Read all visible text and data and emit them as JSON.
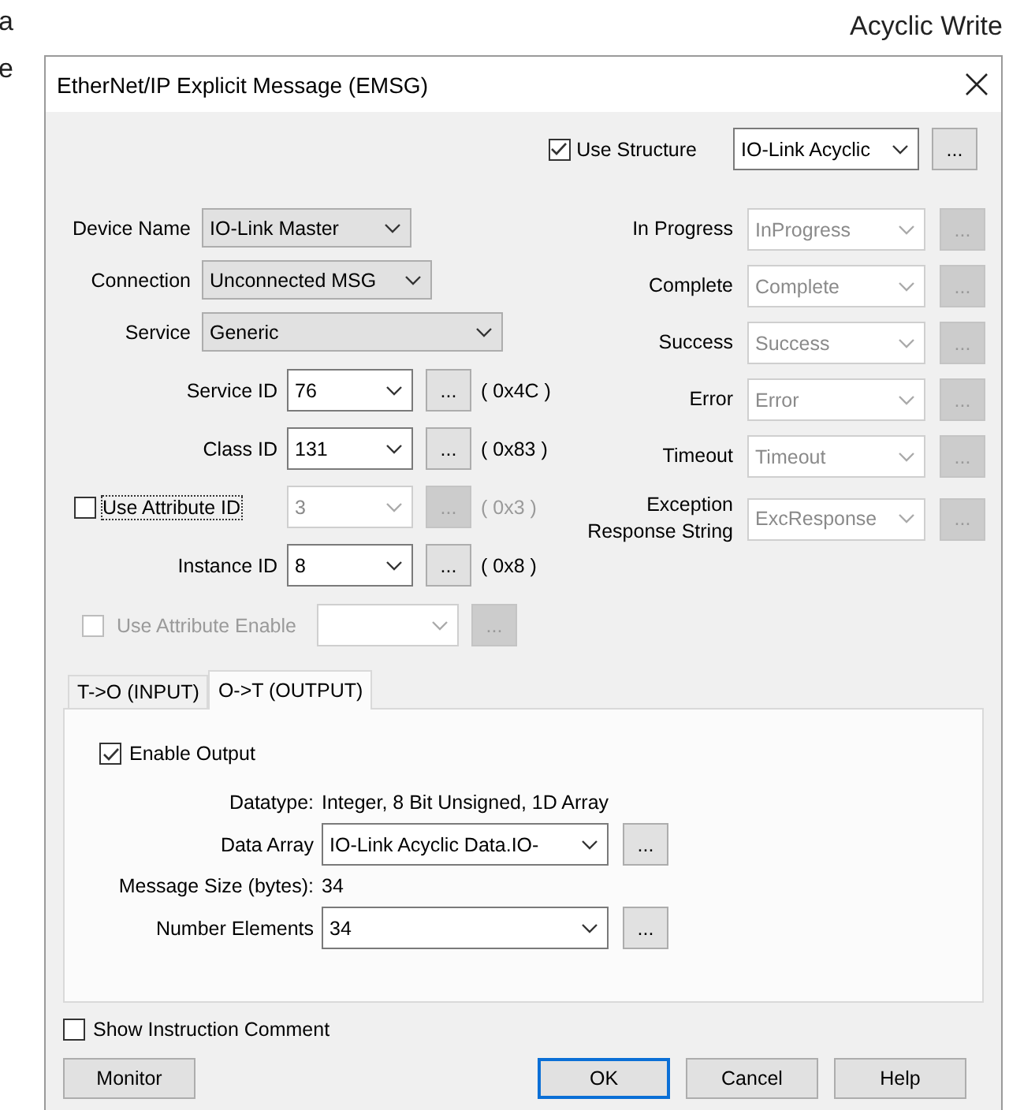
{
  "page_fragments": {
    "left_line_1": "a",
    "left_line_2": "e",
    "heading": "Acyclic Write"
  },
  "window": {
    "title": "EtherNet/IP Explicit Message (EMSG)"
  },
  "use_structure": {
    "label": "Use Structure",
    "checked": true,
    "value": "IO-Link Acyclic",
    "button": "..."
  },
  "left_fields": [
    {
      "kind": "select",
      "label": "Device Name",
      "value": "IO-Link Master",
      "disabled": false
    },
    {
      "kind": "select",
      "label": "Connection",
      "value": "Unconnected MSG",
      "disabled": false
    },
    {
      "kind": "select",
      "label": "Service",
      "value": "Generic",
      "disabled": false
    },
    {
      "kind": "id",
      "label": "Service ID",
      "value": "76",
      "button": "...",
      "hex": "( 0x4C )",
      "disabled": false
    },
    {
      "kind": "id",
      "label": "Class ID",
      "value": "131",
      "button": "...",
      "hex": "( 0x83 )",
      "disabled": false
    },
    {
      "kind": "id_check",
      "label": "Use Attribute ID",
      "checked": false,
      "value": "3",
      "button": "...",
      "hex": "( 0x3 )",
      "disabled": true
    },
    {
      "kind": "id",
      "label": "Instance ID",
      "value": "8",
      "button": "...",
      "hex": "( 0x8 )",
      "disabled": false
    },
    {
      "kind": "enable_check",
      "label": "Use Attribute Enable",
      "checked": false,
      "button": "...",
      "disabled": true
    }
  ],
  "right_fields": [
    {
      "label": "In Progress",
      "value": "InProgress",
      "button": "...",
      "disabled": true
    },
    {
      "label": "Complete",
      "value": "Complete",
      "button": "...",
      "disabled": true
    },
    {
      "label": "Success",
      "value": "Success",
      "button": "...",
      "disabled": true
    },
    {
      "label": "Error",
      "value": "Error",
      "button": "...",
      "disabled": true
    },
    {
      "label": "Timeout",
      "value": "Timeout",
      "button": "...",
      "disabled": true
    },
    {
      "label": "Exception\nResponse String",
      "value": "ExcResponse",
      "button": "...",
      "disabled": true
    }
  ],
  "tabs": [
    {
      "label": "T->O (INPUT)",
      "selected": false
    },
    {
      "label": "O->T (OUTPUT)",
      "selected": true
    }
  ],
  "output_panel": {
    "enable_output": {
      "label": "Enable Output",
      "checked": true
    },
    "datatype": {
      "label": "Datatype:",
      "value": "Integer, 8 Bit Unsigned, 1D Array"
    },
    "data_array": {
      "label": "Data Array",
      "value": "IO-Link Acyclic Data.IO-",
      "button": "..."
    },
    "message_size": {
      "label": "Message Size (bytes):",
      "value": "34"
    },
    "number_elements": {
      "label": "Number Elements",
      "value": "34",
      "button": "..."
    }
  },
  "show_comment": {
    "label": "Show Instruction Comment",
    "checked": false
  },
  "buttons": [
    {
      "label": "Monitor",
      "default": false
    },
    {
      "label": "OK",
      "default": true
    },
    {
      "label": "Cancel",
      "default": false
    },
    {
      "label": "Help",
      "default": false
    }
  ]
}
